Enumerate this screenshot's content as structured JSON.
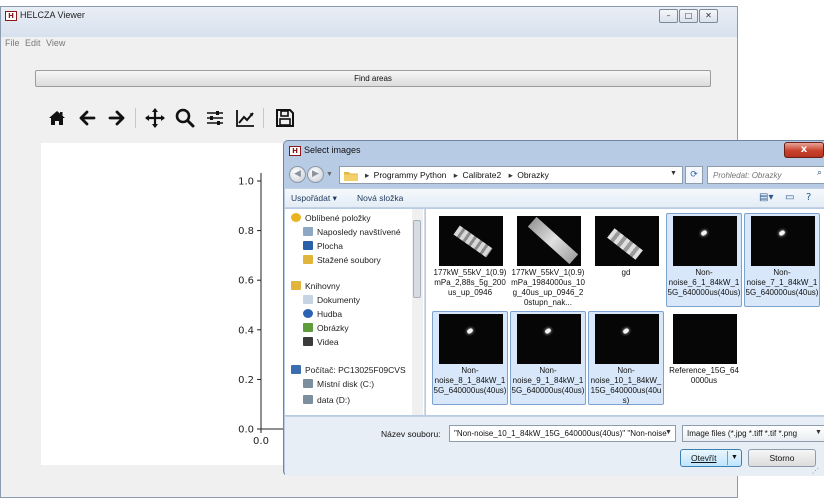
{
  "main_window": {
    "title": "HELCZA Viewer",
    "app_icon_text": "H",
    "controls": [
      "minimize-icon",
      "maximize-icon",
      "close-icon"
    ]
  },
  "menubar": {
    "items": [
      "File",
      "Edit",
      "View"
    ]
  },
  "find_areas_label": "Find areas",
  "toolbar": {
    "icons": [
      "home-icon",
      "back-arrow-icon",
      "forward-arrow-icon",
      "pan-icon",
      "zoom-icon",
      "subplots-config-icon",
      "edit-axis-icon",
      "save-icon"
    ]
  },
  "plot": {
    "y_ticks": [
      "1.0",
      "0.8",
      "0.6",
      "0.4",
      "0.2",
      "0.0"
    ],
    "x_ticks": [
      "0.0"
    ]
  },
  "dialog": {
    "title": "Select images",
    "close_label": "x",
    "breadcrumb": [
      "Programmy Python",
      "Calibrate2",
      "Obrazky"
    ],
    "search_placeholder": "Prohledat: Obrazky",
    "command_bar": {
      "organize": "Uspořádat ▾",
      "new_folder": "Nová složka"
    },
    "nav_items": [
      {
        "label": "Oblíbené položky",
        "icon": "star-icon",
        "color": "#e8b420"
      },
      {
        "label": "Naposledy navštívené",
        "icon": "recent-places-icon",
        "color": "#8da7c4"
      },
      {
        "label": "Plocha",
        "icon": "desktop-icon",
        "color": "#2b5fa8"
      },
      {
        "label": "Stažené soubory",
        "icon": "downloads-icon",
        "color": "#e1b43c"
      },
      {
        "label": "Knihovny",
        "icon": "libraries-icon",
        "color": "#e1b43c"
      },
      {
        "label": "Dokumenty",
        "icon": "documents-icon",
        "color": "#c6d3e3"
      },
      {
        "label": "Hudba",
        "icon": "music-icon",
        "color": "#2a63b4"
      },
      {
        "label": "Obrázky",
        "icon": "pictures-icon",
        "color": "#5f9c3c"
      },
      {
        "label": "Videa",
        "icon": "videos-icon",
        "color": "#3b3b3b"
      },
      {
        "label": "Počítač: PC13025F09CVS",
        "icon": "computer-icon",
        "color": "#3a6eb0"
      },
      {
        "label": "Místní disk (C:)",
        "icon": "local-disk-icon",
        "color": "#7d8e9c"
      },
      {
        "label": "data (D:)",
        "icon": "drive-icon",
        "color": "#7d8e9c"
      }
    ],
    "files": [
      {
        "label": "177kW_55kV_1(0.9)mPa_2,88s_5g_200us_up_0946",
        "selected": false,
        "thumb": "stripe"
      },
      {
        "label": "177kW_55kV_1(0.9)mPa_1984000us_10g_40us_up_0946_20stupn_nak...",
        "selected": false,
        "thumb": "long"
      },
      {
        "label": "gd",
        "selected": false,
        "thumb": "short"
      },
      {
        "label": "Non-noise_6_1_84kW_15G_640000us(40us)",
        "selected": true,
        "thumb": "dot"
      },
      {
        "label": "Non-noise_7_1_84kW_15G_640000us(40us)",
        "selected": true,
        "thumb": "dot"
      },
      {
        "label": "Non-noise_8_1_84kW_15G_640000us(40us)",
        "selected": true,
        "thumb": "dot"
      },
      {
        "label": "Non-noise_9_1_84kW_15G_640000us(40us)",
        "selected": true,
        "thumb": "dot"
      },
      {
        "label": "Non-noise_10_1_84kW_15G_640000us(40us)",
        "selected": true,
        "thumb": "dot"
      },
      {
        "label": "Reference_15G_640000us",
        "selected": false,
        "thumb": "blank"
      }
    ],
    "filename_label": "Název souboru:",
    "filename_value": "\"Non-noise_10_1_84kW_15G_640000us(40us)\" \"Non-noise",
    "filetype_value": "Image files (*.jpg *.tiff *.tif *.png",
    "open_label": "Otevřít",
    "cancel_label": "Storno"
  }
}
